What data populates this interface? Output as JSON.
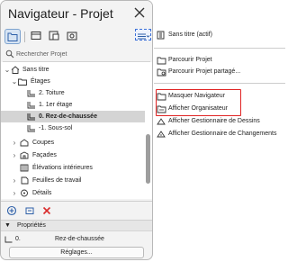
{
  "window": {
    "title": "Navigateur - Projet"
  },
  "search": {
    "placeholder": "Rechercher Projet"
  },
  "tree": {
    "root": "Sans titre",
    "stories_group": "Étages",
    "stories": [
      {
        "label": "2. Toiture"
      },
      {
        "label": "1. 1er étage"
      },
      {
        "label": "0. Rez-de-chaussée",
        "selected": true
      },
      {
        "label": "-1. Sous-sol"
      }
    ],
    "groups": [
      {
        "label": "Coupes"
      },
      {
        "label": "Façades"
      },
      {
        "label": "Élévations intérieures"
      },
      {
        "label": "Feuilles de travail"
      },
      {
        "label": "Détails"
      }
    ]
  },
  "properties": {
    "header": "Propriétés",
    "row_id": "0.",
    "row_name": "Rez-de-chaussée",
    "settings_button": "Réglages..."
  },
  "menu": {
    "items": [
      {
        "label": "Sans titre (actif)",
        "icon": "project-map-icon"
      },
      {
        "label": "Parcourir Projet",
        "icon": "folder-icon"
      },
      {
        "label": "Parcourir Projet partagé...",
        "icon": "shared-project-icon"
      },
      {
        "label": "Masquer Navigateur",
        "icon": "navigator-icon"
      },
      {
        "label": "Afficher Organisateur",
        "icon": "organizer-icon"
      },
      {
        "label": "Afficher Gestionnaire de Dessins",
        "icon": "drawing-manager-icon"
      },
      {
        "label": "Afficher Gestionnaire de Changements",
        "icon": "change-manager-icon"
      }
    ]
  },
  "colors": {
    "accent": "#3a6fd8",
    "highlight_box": "#e02424",
    "delete_red": "#d92b2b",
    "selected_row": "#d4d4d4"
  }
}
